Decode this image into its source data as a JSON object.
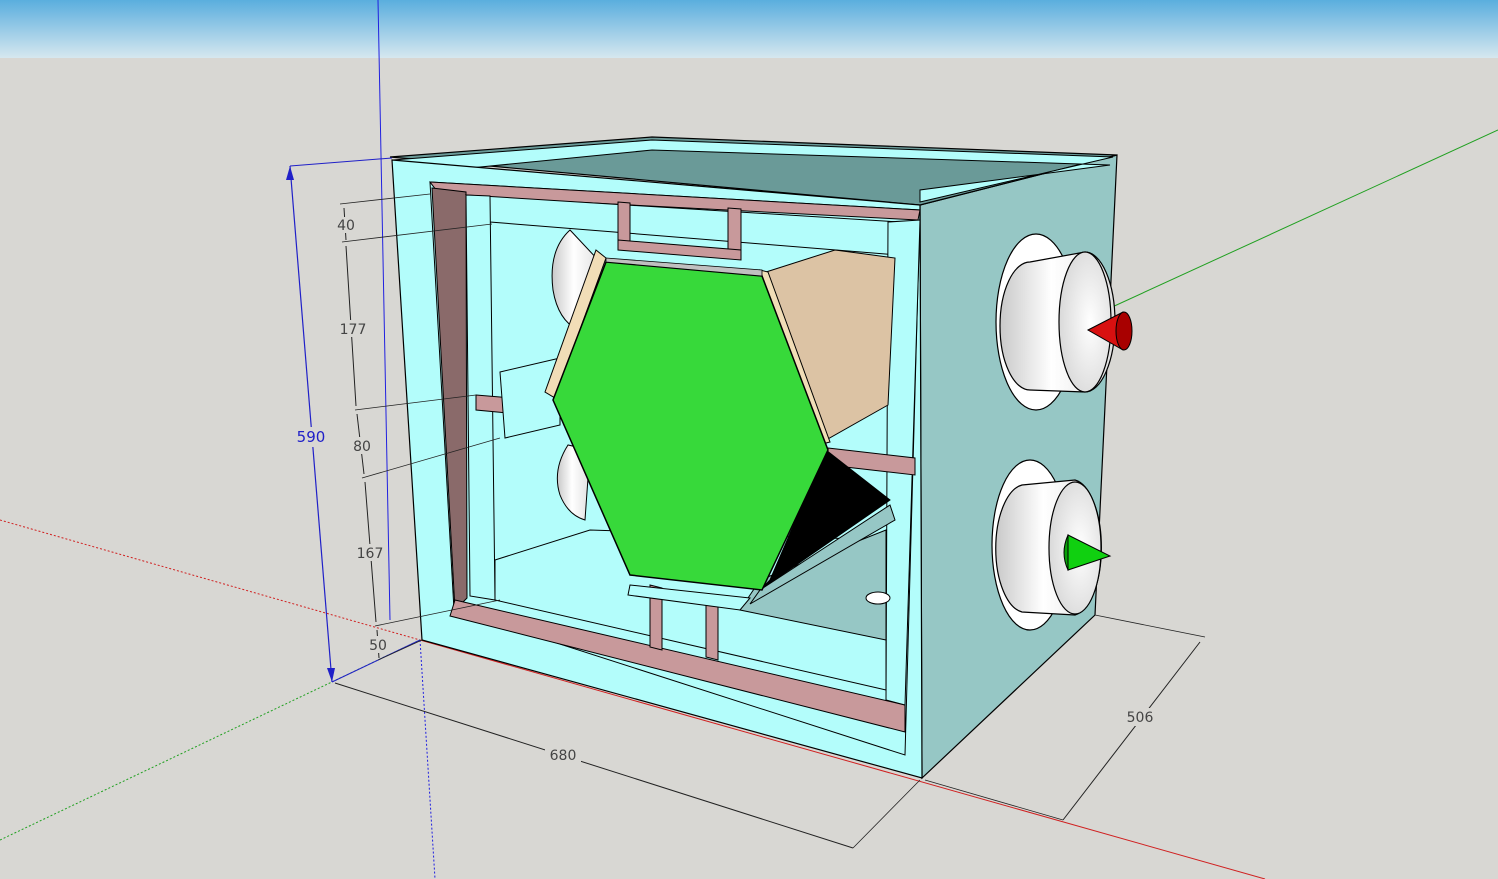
{
  "dimensions": {
    "height_total": "590",
    "width": "680",
    "depth": "506",
    "vertical_segments": [
      "40",
      "177",
      "80",
      "167",
      "50"
    ]
  },
  "colors": {
    "sky_top": "#5aaede",
    "sky_bottom": "#d6e7ef",
    "ground": "#d8d7d3",
    "casing_light": "#b3fdfb",
    "casing_mid": "#96c7c5",
    "casing_dark": "#6a9a98",
    "frame_pink": "#c8999b",
    "frame_dark": "#8a6a6a",
    "hexagon_green": "#37d93a",
    "panel_tan": "#dcc3a4",
    "axis_red": "#d02020",
    "axis_green": "#20a020",
    "axis_blue": "#2020e0",
    "arrow_red": "#d81010",
    "arrow_green": "#10d010"
  }
}
